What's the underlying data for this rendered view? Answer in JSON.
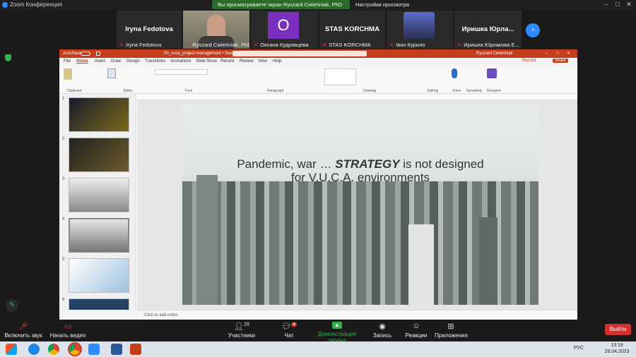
{
  "app_title": "Zoom Конференция",
  "share_banner": "Вы просматриваете экран Ryszard Cwiertniak, PhD",
  "view_options": "Настройки просмотра",
  "participants_tiles": [
    {
      "display": "Iryna Fedotova",
      "caption": "Iryna Fedotova"
    },
    {
      "display": "",
      "caption": "Ryszard Cwiertniak, PhD"
    },
    {
      "display": "О",
      "caption": "Оксана Кудрявцева"
    },
    {
      "display": "STAS KORCHMA",
      "caption": "STAS KORCHMA"
    },
    {
      "display": "",
      "caption": "Іван Курило"
    },
    {
      "display": "Иришка Юрла...",
      "caption": "Иришка Юрлакова Е..."
    }
  ],
  "ppt": {
    "autosave": "AutoSave",
    "filename": "00_vuca_project management • Saved to this PC",
    "user": "Ryszard Cwiertniak",
    "tabs": [
      "File",
      "Home",
      "Insert",
      "Draw",
      "Design",
      "Transitions",
      "Animations",
      "Slide Show",
      "Record",
      "Review",
      "View",
      "Help"
    ],
    "record_btn": "Record",
    "share_btn": "Share",
    "groups": [
      "Clipboard",
      "Slides",
      "Font",
      "Paragraph",
      "Drawing",
      "Editing",
      "Voice",
      "Sensitivity",
      "Designer"
    ],
    "slide_numbers": [
      "1",
      "2",
      "3",
      "4",
      "5",
      "6"
    ],
    "slide_title_line1": "Pandemic, war …",
    "slide_title_bold": "STRATEGY",
    "slide_title_line1_end": "is not designed",
    "slide_title_line2": "for V.U.C.A. environments",
    "notes_placeholder": "Click to add notes"
  },
  "toolbar": {
    "mute": "Включить звук",
    "video": "Начать видео",
    "participants": "Участники",
    "participants_count": "28",
    "chat": "Чат",
    "chat_badge": "4",
    "share": "Демонстрация экрана",
    "record": "Запись",
    "reactions": "Реакции",
    "apps": "Приложения",
    "leave": "Выйти"
  },
  "taskbar": {
    "lang": "РУС",
    "time": "13:19",
    "date": "28.04.2023"
  },
  "colors": {
    "zoom_blue": "#2d8cff",
    "ppt_red": "#c43e1c",
    "share_green": "#2b6a2b",
    "leave_red": "#d3302f"
  }
}
